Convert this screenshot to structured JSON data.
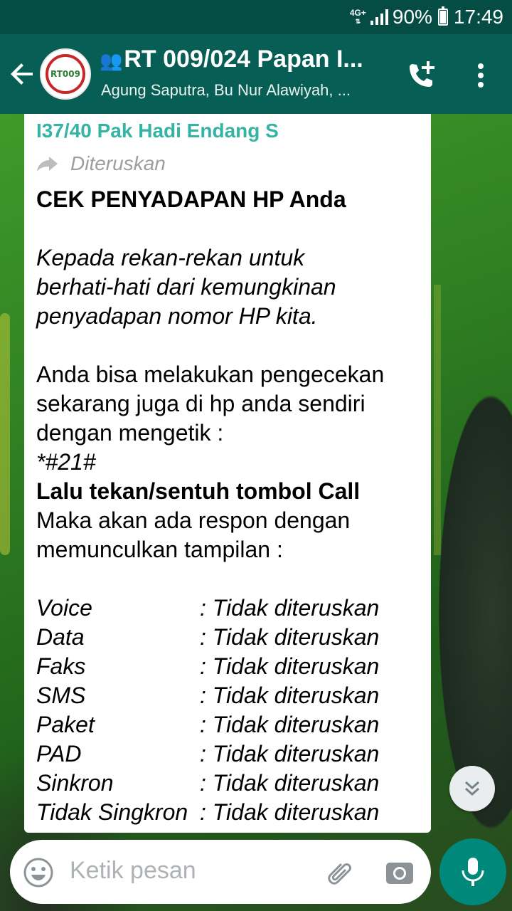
{
  "status_bar": {
    "network": "4G+",
    "battery": "90%",
    "time": "17:49"
  },
  "header": {
    "title": "RT 009/024 Papan I...",
    "subtitle": "Agung Saputra, Bu Nur Alawiyah, ...",
    "avatar_text": "RT009"
  },
  "message": {
    "sender": "I37/40 Pak Hadi Endang S",
    "forwarded_label": "Diteruskan",
    "heading": "CEK PENYADAPAN HP Anda",
    "intro_lines": [
      "Kepada rekan-rekan untuk",
      "berhati-hati dari kemungkinan",
      "penyadapan nomor HP kita."
    ],
    "body_lines": [
      "Anda bisa melakukan pengecekan",
      "sekarang juga di hp anda sendiri",
      "dengan mengetik :"
    ],
    "code": "*#21#",
    "instruction": "Lalu tekan/sentuh tombol Call",
    "response_lines": [
      "Maka akan ada respon dengan",
      "memunculkan tampilan :"
    ],
    "rows": [
      {
        "key": "Voice",
        "value": ": Tidak diteruskan"
      },
      {
        "key": "Data",
        "value": ": Tidak diteruskan"
      },
      {
        "key": "Faks",
        "value": ": Tidak diteruskan"
      },
      {
        "key": "SMS",
        "value": ": Tidak diteruskan"
      },
      {
        "key": "Paket",
        "value": ": Tidak diteruskan"
      },
      {
        "key": "PAD",
        "value": ": Tidak diteruskan"
      },
      {
        "key": "Sinkron",
        "value": ": Tidak diteruskan"
      },
      {
        "key": "Tidak Singkron",
        "value": ": Tidak diteruskan"
      }
    ]
  },
  "input": {
    "placeholder": "Ketik pesan"
  },
  "icons": {
    "back": "arrow-left-icon",
    "call_add": "phone-plus-icon",
    "menu": "more-vert-icon",
    "forward": "forward-arrow-icon",
    "scroll": "chevron-double-down-icon",
    "emoji": "emoji-icon",
    "attach": "paperclip-icon",
    "camera": "camera-icon",
    "mic": "mic-icon"
  },
  "colors": {
    "header": "#075e54",
    "status_bar": "#054d44",
    "sender": "#35b3a4",
    "mic_button": "#00897b"
  }
}
